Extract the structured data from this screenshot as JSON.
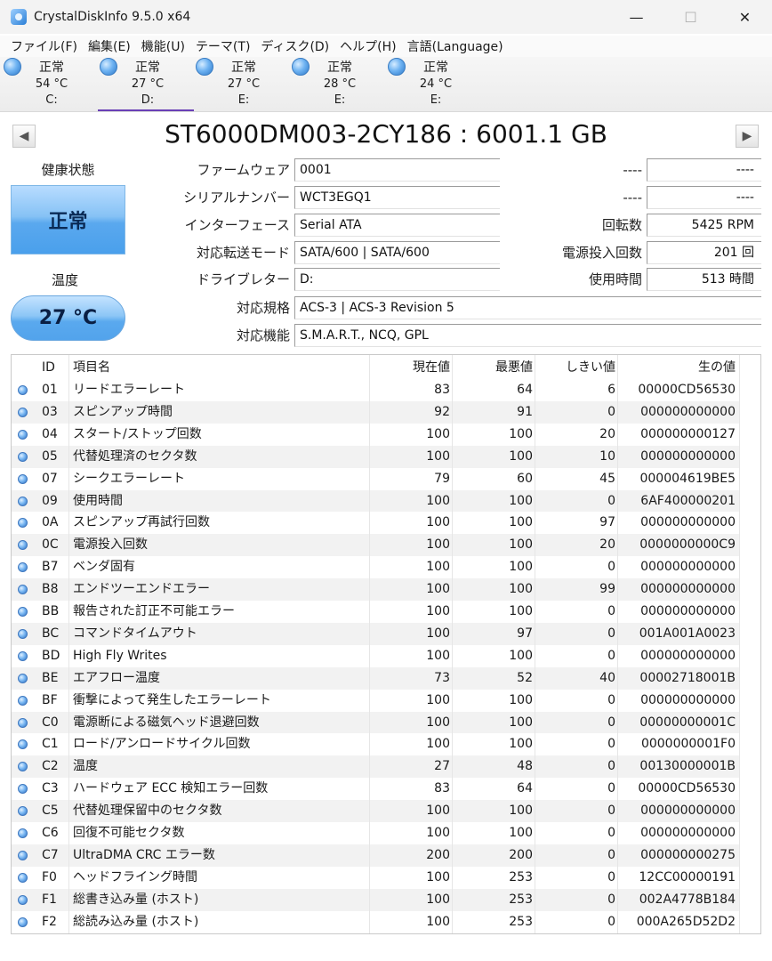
{
  "window": {
    "title": "CrystalDiskInfo 9.5.0 x64",
    "minimize": "—",
    "maximize": "☐",
    "close": "✕"
  },
  "menu": [
    "ファイル(F)",
    "編集(E)",
    "機能(U)",
    "テーマ(T)",
    "ディスク(D)",
    "ヘルプ(H)",
    "言語(Language)"
  ],
  "drives": [
    {
      "status": "正常",
      "temp": "54 °C",
      "letter": "C:"
    },
    {
      "status": "正常",
      "temp": "27 °C",
      "letter": "D:"
    },
    {
      "status": "正常",
      "temp": "27 °C",
      "letter": "E:"
    },
    {
      "status": "正常",
      "temp": "28 °C",
      "letter": "E:"
    },
    {
      "status": "正常",
      "temp": "24 °C",
      "letter": "E:"
    }
  ],
  "model": "ST6000DM003-2CY186 : 6001.1 GB",
  "nav": {
    "prev": "◀",
    "next": "▶"
  },
  "health": {
    "label": "健康状態",
    "value": "正常"
  },
  "temperature": {
    "label": "温度",
    "value": "27 °C"
  },
  "info": {
    "firmware_label": "ファームウェア",
    "firmware": "0001",
    "serial_label": "シリアルナンバー",
    "serial": "WCT3EGQ1",
    "interface_label": "インターフェース",
    "interface": "Serial ATA",
    "transfer_label": "対応転送モード",
    "transfer": "SATA/600 | SATA/600",
    "letter_label": "ドライブレター",
    "letter": "D:",
    "standard_label": "対応規格",
    "standard": "ACS-3 | ACS-3 Revision 5",
    "features_label": "対応機能",
    "features": "S.M.A.R.T., NCQ, GPL",
    "dash1_label": "----",
    "dash1": "----",
    "dash2_label": "----",
    "dash2": "----",
    "rpm_label": "回転数",
    "rpm": "5425 RPM",
    "power_count_label": "電源投入回数",
    "power_count": "201 回",
    "hours_label": "使用時間",
    "hours": "513 時間"
  },
  "smart": {
    "headers": {
      "id": "ID",
      "name": "項目名",
      "current": "現在値",
      "worst": "最悪値",
      "threshold": "しきい値",
      "raw": "生の値"
    },
    "rows": [
      {
        "id": "01",
        "name": "リードエラーレート",
        "current": "83",
        "worst": "64",
        "threshold": "6",
        "raw": "00000CD56530"
      },
      {
        "id": "03",
        "name": "スピンアップ時間",
        "current": "92",
        "worst": "91",
        "threshold": "0",
        "raw": "000000000000"
      },
      {
        "id": "04",
        "name": "スタート/ストップ回数",
        "current": "100",
        "worst": "100",
        "threshold": "20",
        "raw": "000000000127"
      },
      {
        "id": "05",
        "name": "代替処理済のセクタ数",
        "current": "100",
        "worst": "100",
        "threshold": "10",
        "raw": "000000000000"
      },
      {
        "id": "07",
        "name": "シークエラーレート",
        "current": "79",
        "worst": "60",
        "threshold": "45",
        "raw": "000004619BE5"
      },
      {
        "id": "09",
        "name": "使用時間",
        "current": "100",
        "worst": "100",
        "threshold": "0",
        "raw": "6AF400000201"
      },
      {
        "id": "0A",
        "name": "スピンアップ再試行回数",
        "current": "100",
        "worst": "100",
        "threshold": "97",
        "raw": "000000000000"
      },
      {
        "id": "0C",
        "name": "電源投入回数",
        "current": "100",
        "worst": "100",
        "threshold": "20",
        "raw": "0000000000C9"
      },
      {
        "id": "B7",
        "name": "ベンダ固有",
        "current": "100",
        "worst": "100",
        "threshold": "0",
        "raw": "000000000000"
      },
      {
        "id": "B8",
        "name": "エンドツーエンドエラー",
        "current": "100",
        "worst": "100",
        "threshold": "99",
        "raw": "000000000000"
      },
      {
        "id": "BB",
        "name": "報告された訂正不可能エラー",
        "current": "100",
        "worst": "100",
        "threshold": "0",
        "raw": "000000000000"
      },
      {
        "id": "BC",
        "name": "コマンドタイムアウト",
        "current": "100",
        "worst": "97",
        "threshold": "0",
        "raw": "001A001A0023"
      },
      {
        "id": "BD",
        "name": "High Fly Writes",
        "current": "100",
        "worst": "100",
        "threshold": "0",
        "raw": "000000000000"
      },
      {
        "id": "BE",
        "name": "エアフロー温度",
        "current": "73",
        "worst": "52",
        "threshold": "40",
        "raw": "00002718001B"
      },
      {
        "id": "BF",
        "name": "衝撃によって発生したエラーレート",
        "current": "100",
        "worst": "100",
        "threshold": "0",
        "raw": "000000000000"
      },
      {
        "id": "C0",
        "name": "電源断による磁気ヘッド退避回数",
        "current": "100",
        "worst": "100",
        "threshold": "0",
        "raw": "00000000001C"
      },
      {
        "id": "C1",
        "name": "ロード/アンロードサイクル回数",
        "current": "100",
        "worst": "100",
        "threshold": "0",
        "raw": "0000000001F0"
      },
      {
        "id": "C2",
        "name": "温度",
        "current": "27",
        "worst": "48",
        "threshold": "0",
        "raw": "00130000001B"
      },
      {
        "id": "C3",
        "name": "ハードウェア ECC 検知エラー回数",
        "current": "83",
        "worst": "64",
        "threshold": "0",
        "raw": "00000CD56530"
      },
      {
        "id": "C5",
        "name": "代替処理保留中のセクタ数",
        "current": "100",
        "worst": "100",
        "threshold": "0",
        "raw": "000000000000"
      },
      {
        "id": "C6",
        "name": "回復不可能セクタ数",
        "current": "100",
        "worst": "100",
        "threshold": "0",
        "raw": "000000000000"
      },
      {
        "id": "C7",
        "name": "UltraDMA CRC エラー数",
        "current": "200",
        "worst": "200",
        "threshold": "0",
        "raw": "000000000275"
      },
      {
        "id": "F0",
        "name": "ヘッドフライング時間",
        "current": "100",
        "worst": "253",
        "threshold": "0",
        "raw": "12CC00000191"
      },
      {
        "id": "F1",
        "name": "総書き込み量 (ホスト)",
        "current": "100",
        "worst": "253",
        "threshold": "0",
        "raw": "002A4778B184"
      },
      {
        "id": "F2",
        "name": "総読み込み量 (ホスト)",
        "current": "100",
        "worst": "253",
        "threshold": "0",
        "raw": "000A265D52D2"
      }
    ]
  }
}
